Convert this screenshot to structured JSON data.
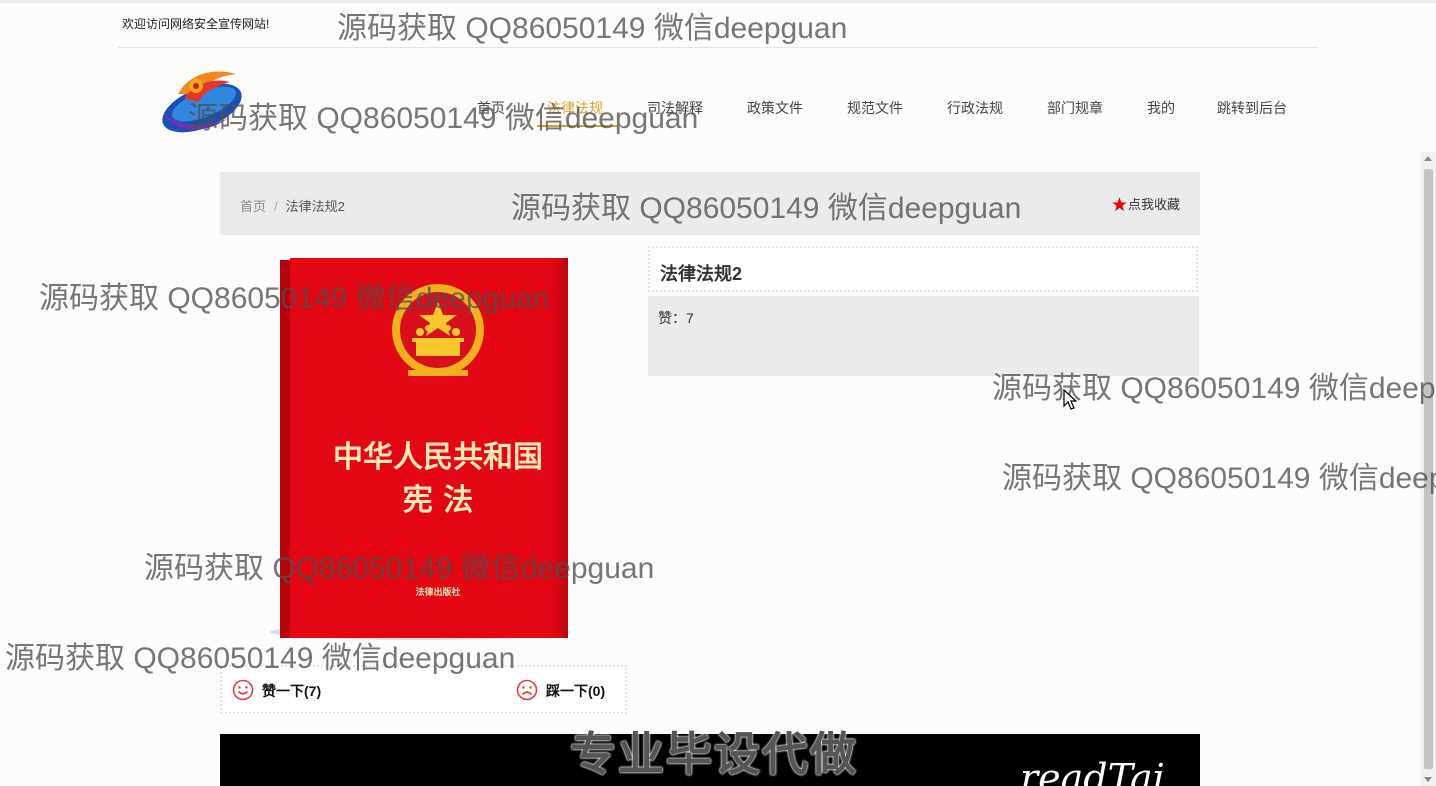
{
  "header": {
    "welcome": "欢迎访问网络安全宣传网站!"
  },
  "nav": {
    "items": [
      {
        "label": "首页"
      },
      {
        "label": "法律法规"
      },
      {
        "label": "司法解释"
      },
      {
        "label": "政策文件"
      },
      {
        "label": "规范文件"
      },
      {
        "label": "行政法规"
      },
      {
        "label": "部门规章"
      },
      {
        "label": "我的"
      },
      {
        "label": "跳转到后台"
      }
    ],
    "active_index": 1,
    "active_color": "#d9a22d"
  },
  "breadcrumb": {
    "home": "首页",
    "separator": "/",
    "current": "法律法规2"
  },
  "favorite": {
    "icon": "★",
    "label": "点我收藏"
  },
  "book": {
    "title_line1": "中华人民共和国",
    "title_line2": "宪 法",
    "publisher": "法律出版社",
    "cover_color": "#e30613"
  },
  "detail": {
    "title": "法律法规2",
    "likes_label": "赞：7"
  },
  "votes": {
    "up": "赞一下(7)",
    "down": "踩一下(0)"
  },
  "video": {
    "subtitle": "专业毕设代做",
    "script_text": "readTai"
  },
  "watermark": "源码获取 QQ86050149 微信deepguan"
}
